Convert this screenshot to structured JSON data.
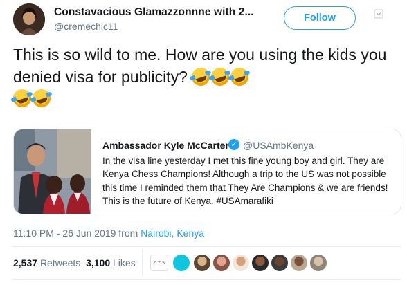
{
  "author": {
    "display_name": "Constavacious Glamazzonnne with 2...",
    "handle": "@cremechic11",
    "follow_label": "Follow"
  },
  "tweet": {
    "text": "This is so wild to me. How are you using the kids you denied visa for publicity?",
    "emoji_count": 5
  },
  "quoted": {
    "name": "Ambassador Kyle McCarter",
    "handle": "@USAmbKenya",
    "text": "In the visa line yesterday I met this fine young boy and girl. They are Kenya Chess Champions! Although a trip to the US was not possible this time I reminded them that They Are Champions & we are friends! This is the future of Kenya. #USAmarafiki"
  },
  "meta": {
    "timestamp": "11:10 PM - 26 Jun 2019 from ",
    "location": "Nairobi, Kenya"
  },
  "stats": {
    "retweets_count": "2,537",
    "retweets_label": "Retweets",
    "likes_count": "3,100",
    "likes_label": "Likes"
  },
  "colors": {
    "accent": "#1da1f2",
    "secondary_text": "#657786"
  }
}
